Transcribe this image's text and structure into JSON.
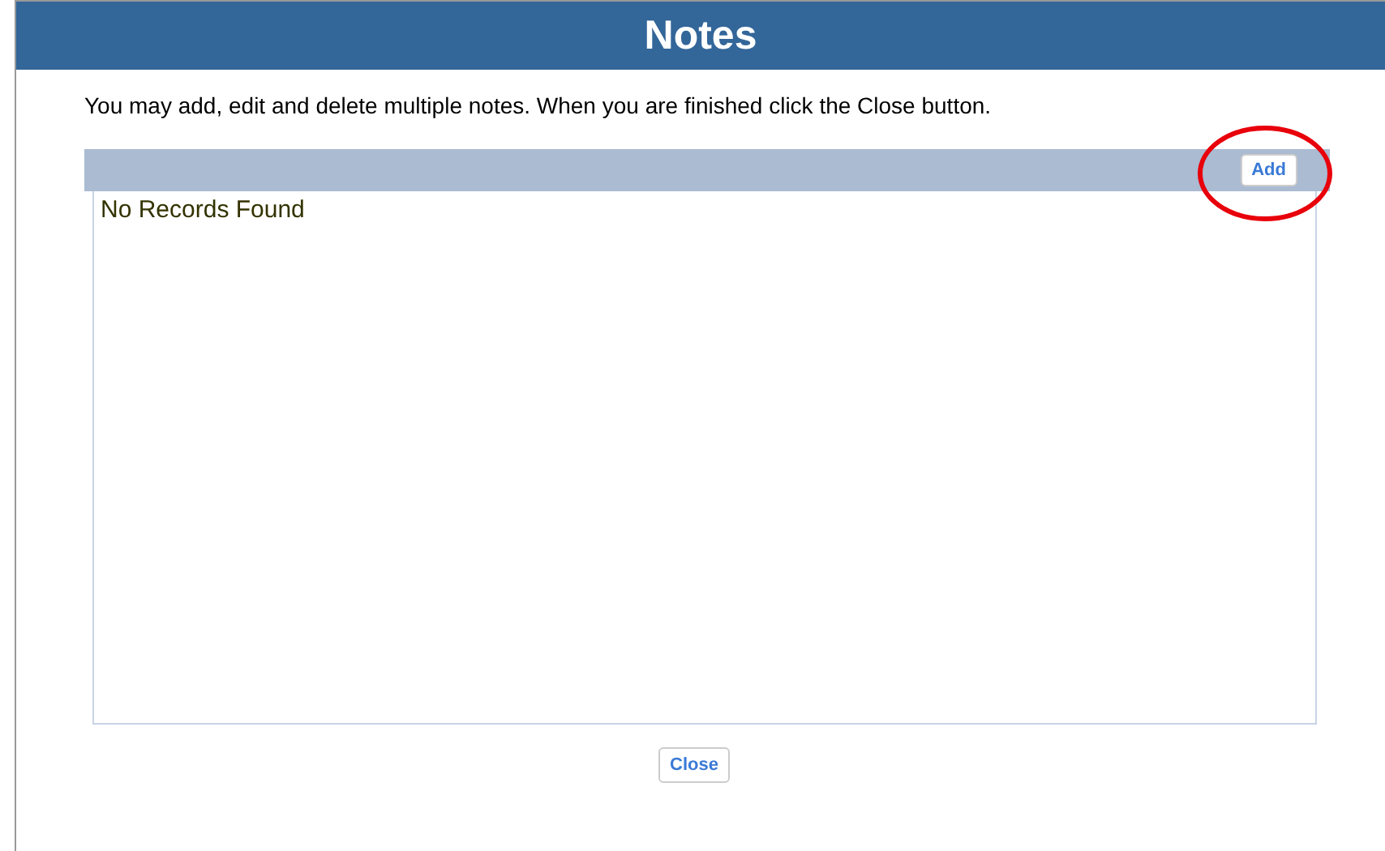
{
  "window": {
    "title": "Notes"
  },
  "instructions": "You may add, edit and delete multiple notes. When you are finished click the Close button.",
  "grid": {
    "add_button": "Add",
    "empty_message": "No Records Found"
  },
  "annotation": {
    "kind": "ellipse",
    "color": "#e8000b"
  },
  "buttons": [
    "Close"
  ]
}
